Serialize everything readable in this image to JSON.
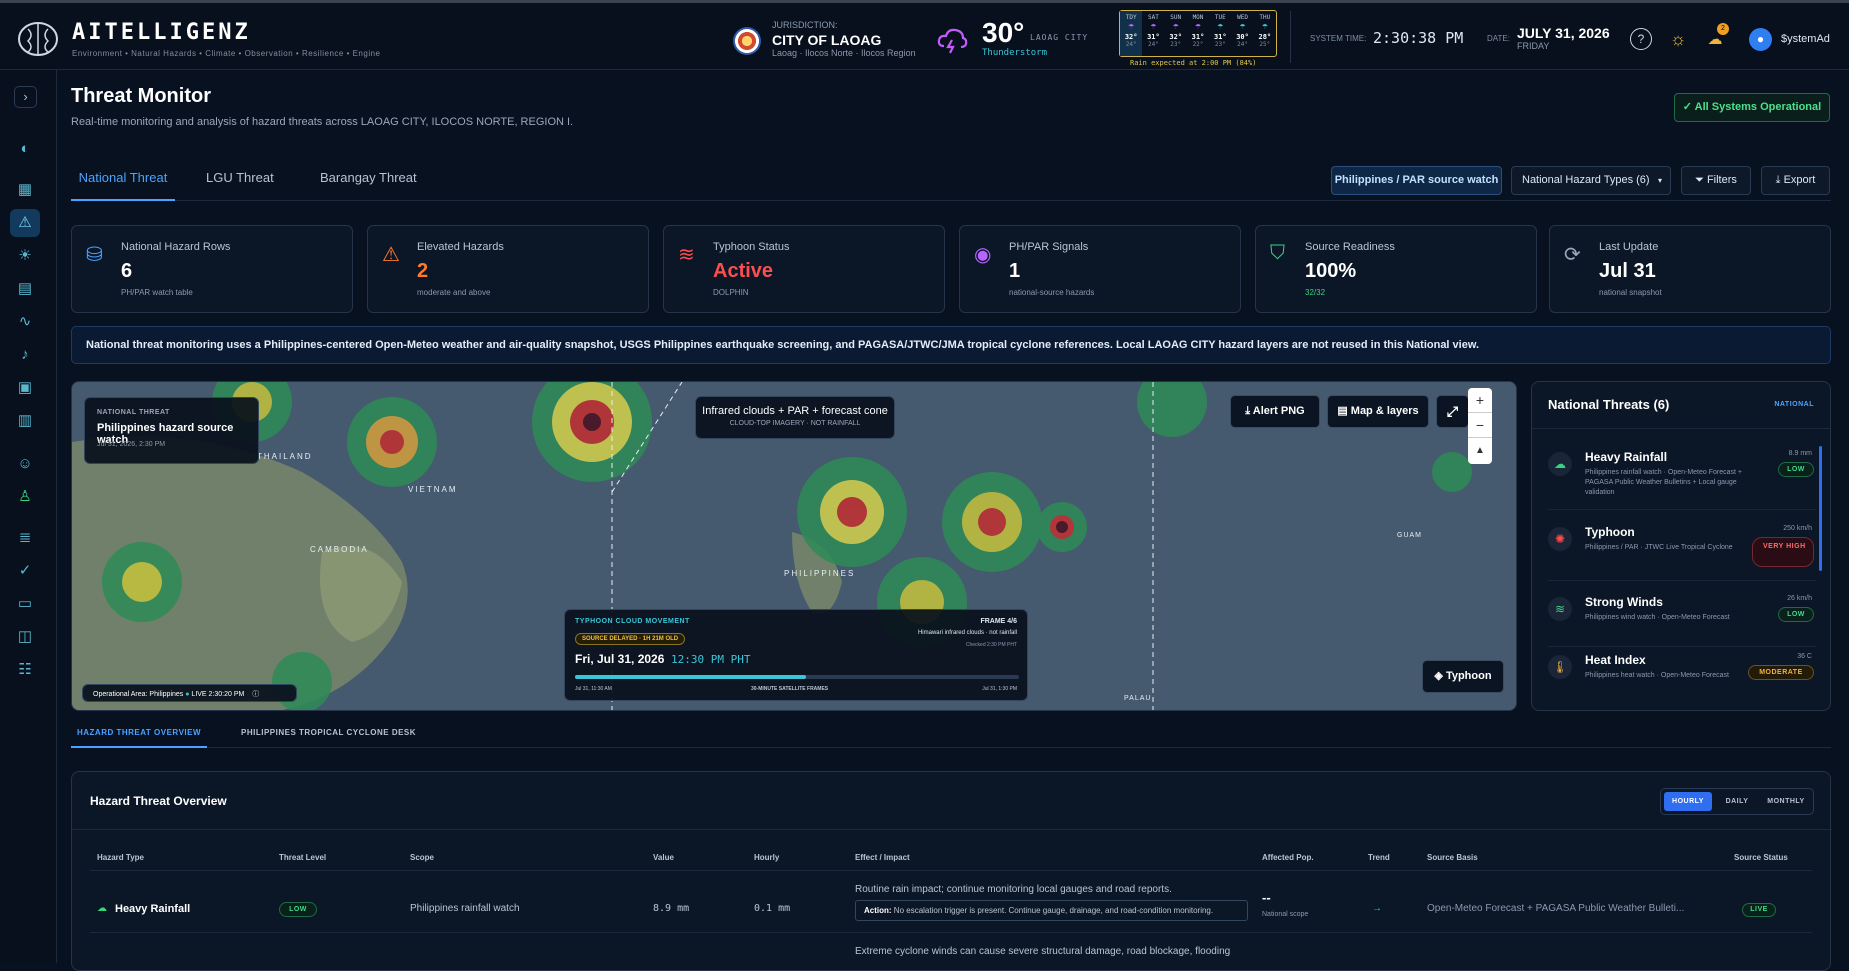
{
  "app": {
    "brand": "AITELLIGENZ",
    "tagline": "Environment • Natural Hazards • Climate • Observation • Resilience • Engine"
  },
  "jurisdiction": {
    "label": "JURISDICTION:",
    "name": "CITY OF LAOAG",
    "region": "Laoag · Ilocos Norte · Ilocos Region"
  },
  "weather": {
    "temp": "30°",
    "place": "LAOAG CITY",
    "condition": "Thunderstorm",
    "rain_note": "Rain expected at 2:00 PM (84%)",
    "forecast": [
      {
        "day": "TDY",
        "hi": "32°",
        "lo": "24°"
      },
      {
        "day": "SAT",
        "hi": "31°",
        "lo": "24°"
      },
      {
        "day": "SUN",
        "hi": "32°",
        "lo": "23°"
      },
      {
        "day": "MON",
        "hi": "31°",
        "lo": "22°"
      },
      {
        "day": "TUE",
        "hi": "31°",
        "lo": "23°"
      },
      {
        "day": "WED",
        "hi": "30°",
        "lo": "24°"
      },
      {
        "day": "THU",
        "hi": "28°",
        "lo": "25°"
      }
    ]
  },
  "system": {
    "time_label": "SYSTEM TIME:",
    "time": "2:30:38 PM",
    "date_label": "DATE:",
    "date": "JULY 31, 2026",
    "weekday": "FRIDAY",
    "notif_count": "2",
    "user": "$ystemAd"
  },
  "page": {
    "title": "Threat Monitor",
    "subtitle": "Real-time monitoring and analysis of hazard threats across LAOAG CITY, ILOCOS NORTE, REGION I.",
    "status_button": "All Systems Operational"
  },
  "tabs": [
    "National Threat",
    "LGU Threat",
    "Barangay Threat"
  ],
  "toolbar": {
    "source_watch": "Philippines / PAR source watch",
    "hazard_types": "National Hazard Types (6)",
    "filters": "Filters",
    "export": "Export"
  },
  "kpis": [
    {
      "title": "National Hazard Rows",
      "value": "6",
      "sub": "PH/PAR watch table",
      "icon": "database-icon",
      "color": "#4aa3ff"
    },
    {
      "title": "Elevated Hazards",
      "value": "2",
      "sub": "moderate and above",
      "icon": "warning-icon",
      "color": "#ff7a2a"
    },
    {
      "title": "Typhoon Status",
      "value": "Active",
      "sub": "DOLPHIN",
      "icon": "wind-icon",
      "color": "#ff4d4d"
    },
    {
      "title": "PH/PAR Signals",
      "value": "1",
      "sub": "national-source hazards",
      "icon": "signal-icon",
      "color": "#b564ff"
    },
    {
      "title": "Source Readiness",
      "value": "100%",
      "sub": "32/32",
      "icon": "shield-check-icon",
      "color": "#3ad47e"
    },
    {
      "title": "Last Update",
      "value": "Jul 31",
      "sub": "national snapshot",
      "icon": "refresh-icon",
      "color": "#9aa8bb"
    }
  ],
  "info_banner": "National threat monitoring uses a Philippines-centered Open-Meteo weather and air-quality snapshot, USGS Philippines earthquake screening, and PAGASA/JTWC/JMA tropical cyclone references. Local LAOAG CITY hazard layers are not reused in this National view.",
  "map": {
    "card_label": "NATIONAL THREAT",
    "card_title": "Philippines hazard source watch",
    "card_time": "Jul 31, 2026, 2:30 PM",
    "overlay_title": "Infrared clouds + PAR + forecast cone",
    "overlay_sub": "CLOUD-TOP IMAGERY · NOT RAINFALL",
    "alert_btn": "Alert PNG",
    "layers_btn": "Map & layers",
    "typhoon_btn": "Typhoon",
    "labels": [
      "THAILAND",
      "VIETNAM",
      "CAMBODIA",
      "PHILIPPINES",
      "GUAM",
      "PALAU"
    ],
    "op_area": "Operational Area: Philippines",
    "live": "LIVE 2:30:20 PM",
    "movement": {
      "title": "TYPHOON CLOUD MOVEMENT",
      "delay": "SOURCE DELAYED · 1H 21M OLD",
      "frame": "FRAME 4/6",
      "frame_note": "Himawari infrared clouds · not rainfall",
      "checked": "Checked 2:30 PM PHT",
      "date": "Fri, Jul 31, 2026",
      "time": "12:30 PM PHT",
      "start": "Jul 31, 11:30 AM",
      "mid": "30-MINUTE SATELLITE FRAMES",
      "end": "Jul 31, 1:30 PM",
      "progress": 0.52
    }
  },
  "national_threats": {
    "title": "National Threats (6)",
    "badge": "NATIONAL",
    "items": [
      {
        "name": "Heavy Rainfall",
        "desc": "Philippines rainfall watch · Open-Meteo Forecast + PAGASA Public Weather Bulletins + Local gauge validation",
        "value": "8.9 mm",
        "level": "LOW",
        "icon": "rain-cloud-icon"
      },
      {
        "name": "Typhoon",
        "desc": "Philippines / PAR · JTWC Live Tropical Cyclone",
        "value": "250 km/h",
        "level": "VERY HIGH",
        "icon": "typhoon-icon"
      },
      {
        "name": "Strong Winds",
        "desc": "Philippines wind watch · Open-Meteo Forecast",
        "value": "26 km/h",
        "level": "LOW",
        "icon": "wind-icon"
      },
      {
        "name": "Heat Index",
        "desc": "Philippines heat watch · Open-Meteo Forecast",
        "value": "36 C",
        "level": "MODERATE",
        "icon": "thermometer-icon"
      }
    ]
  },
  "section_tabs": [
    "HAZARD THREAT OVERVIEW",
    "PHILIPPINES TROPICAL CYCLONE DESK"
  ],
  "overview": {
    "title": "Hazard Threat Overview",
    "toggle": [
      "HOURLY",
      "DAILY",
      "MONTHLY"
    ],
    "headers": [
      "Hazard Type",
      "Threat Level",
      "Scope",
      "Value",
      "Hourly",
      "Effect / Impact",
      "Affected Pop.",
      "Trend",
      "Source Basis",
      "Source Status"
    ],
    "rows": [
      {
        "type": "Heavy Rainfall",
        "level": "LOW",
        "scope": "Philippines rainfall watch",
        "value": "8.9 mm",
        "hourly": "0.1 mm",
        "effect": "Routine rain impact; continue monitoring local gauges and road reports.",
        "action_label": "Action:",
        "action": "No escalation trigger is present. Continue gauge, drainage, and road-condition monitoring.",
        "pop": "--",
        "pop_sub": "National scope",
        "trend": "→",
        "source": "Open-Meteo Forecast + PAGASA Public Weather Bulleti...",
        "status": "LIVE"
      }
    ],
    "next_effect": "Extreme cyclone winds can cause severe structural damage, road blockage, flooding"
  }
}
